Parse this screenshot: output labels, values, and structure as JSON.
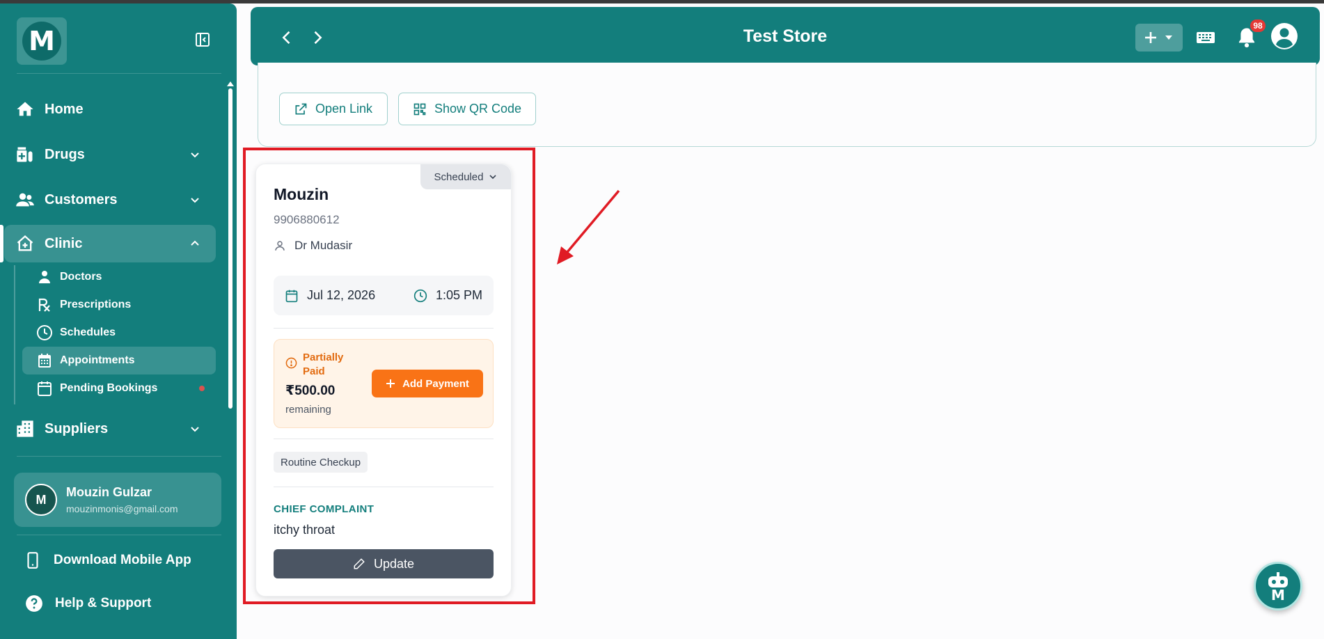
{
  "app": {
    "logo_letter": "M",
    "store_name": "Test Store",
    "notification_count": "98",
    "accent_color": "#137e7c"
  },
  "sidebar": {
    "items": [
      {
        "label": "Home",
        "icon": "home-icon"
      },
      {
        "label": "Drugs",
        "icon": "drugs-icon"
      },
      {
        "label": "Customers",
        "icon": "customers-icon"
      },
      {
        "label": "Clinic",
        "icon": "clinic-icon"
      },
      {
        "label": "Suppliers",
        "icon": "suppliers-icon"
      }
    ],
    "clinic_sub": [
      {
        "label": "Doctors",
        "icon": "doctor-icon"
      },
      {
        "label": "Prescriptions",
        "icon": "rx-icon"
      },
      {
        "label": "Schedules",
        "icon": "clock-icon"
      },
      {
        "label": "Appointments",
        "icon": "calendar-icon"
      },
      {
        "label": "Pending Bookings",
        "icon": "calendar-blank-icon"
      }
    ],
    "user": {
      "initial": "M",
      "name": "Mouzin Gulzar",
      "email": "mouzinmonis@gmail.com"
    },
    "download_app": "Download Mobile App",
    "help": "Help & Support"
  },
  "link_panel": {
    "open_link": "Open Link",
    "show_qr": "Show QR Code"
  },
  "appointment": {
    "status": "Scheduled",
    "patient_name": "Mouzin",
    "phone": "9906880612",
    "doctor": "Dr Mudasir",
    "date": "Jul 12, 2026",
    "time": "1:05 PM",
    "payment_status": "Partially Paid",
    "amount": "₹500.00",
    "remaining_label": "remaining",
    "add_payment": "Add Payment",
    "type": "Routine Checkup",
    "chief_complaint_label": "CHIEF COMPLAINT",
    "chief_complaint": "itchy throat",
    "update": "Update"
  }
}
